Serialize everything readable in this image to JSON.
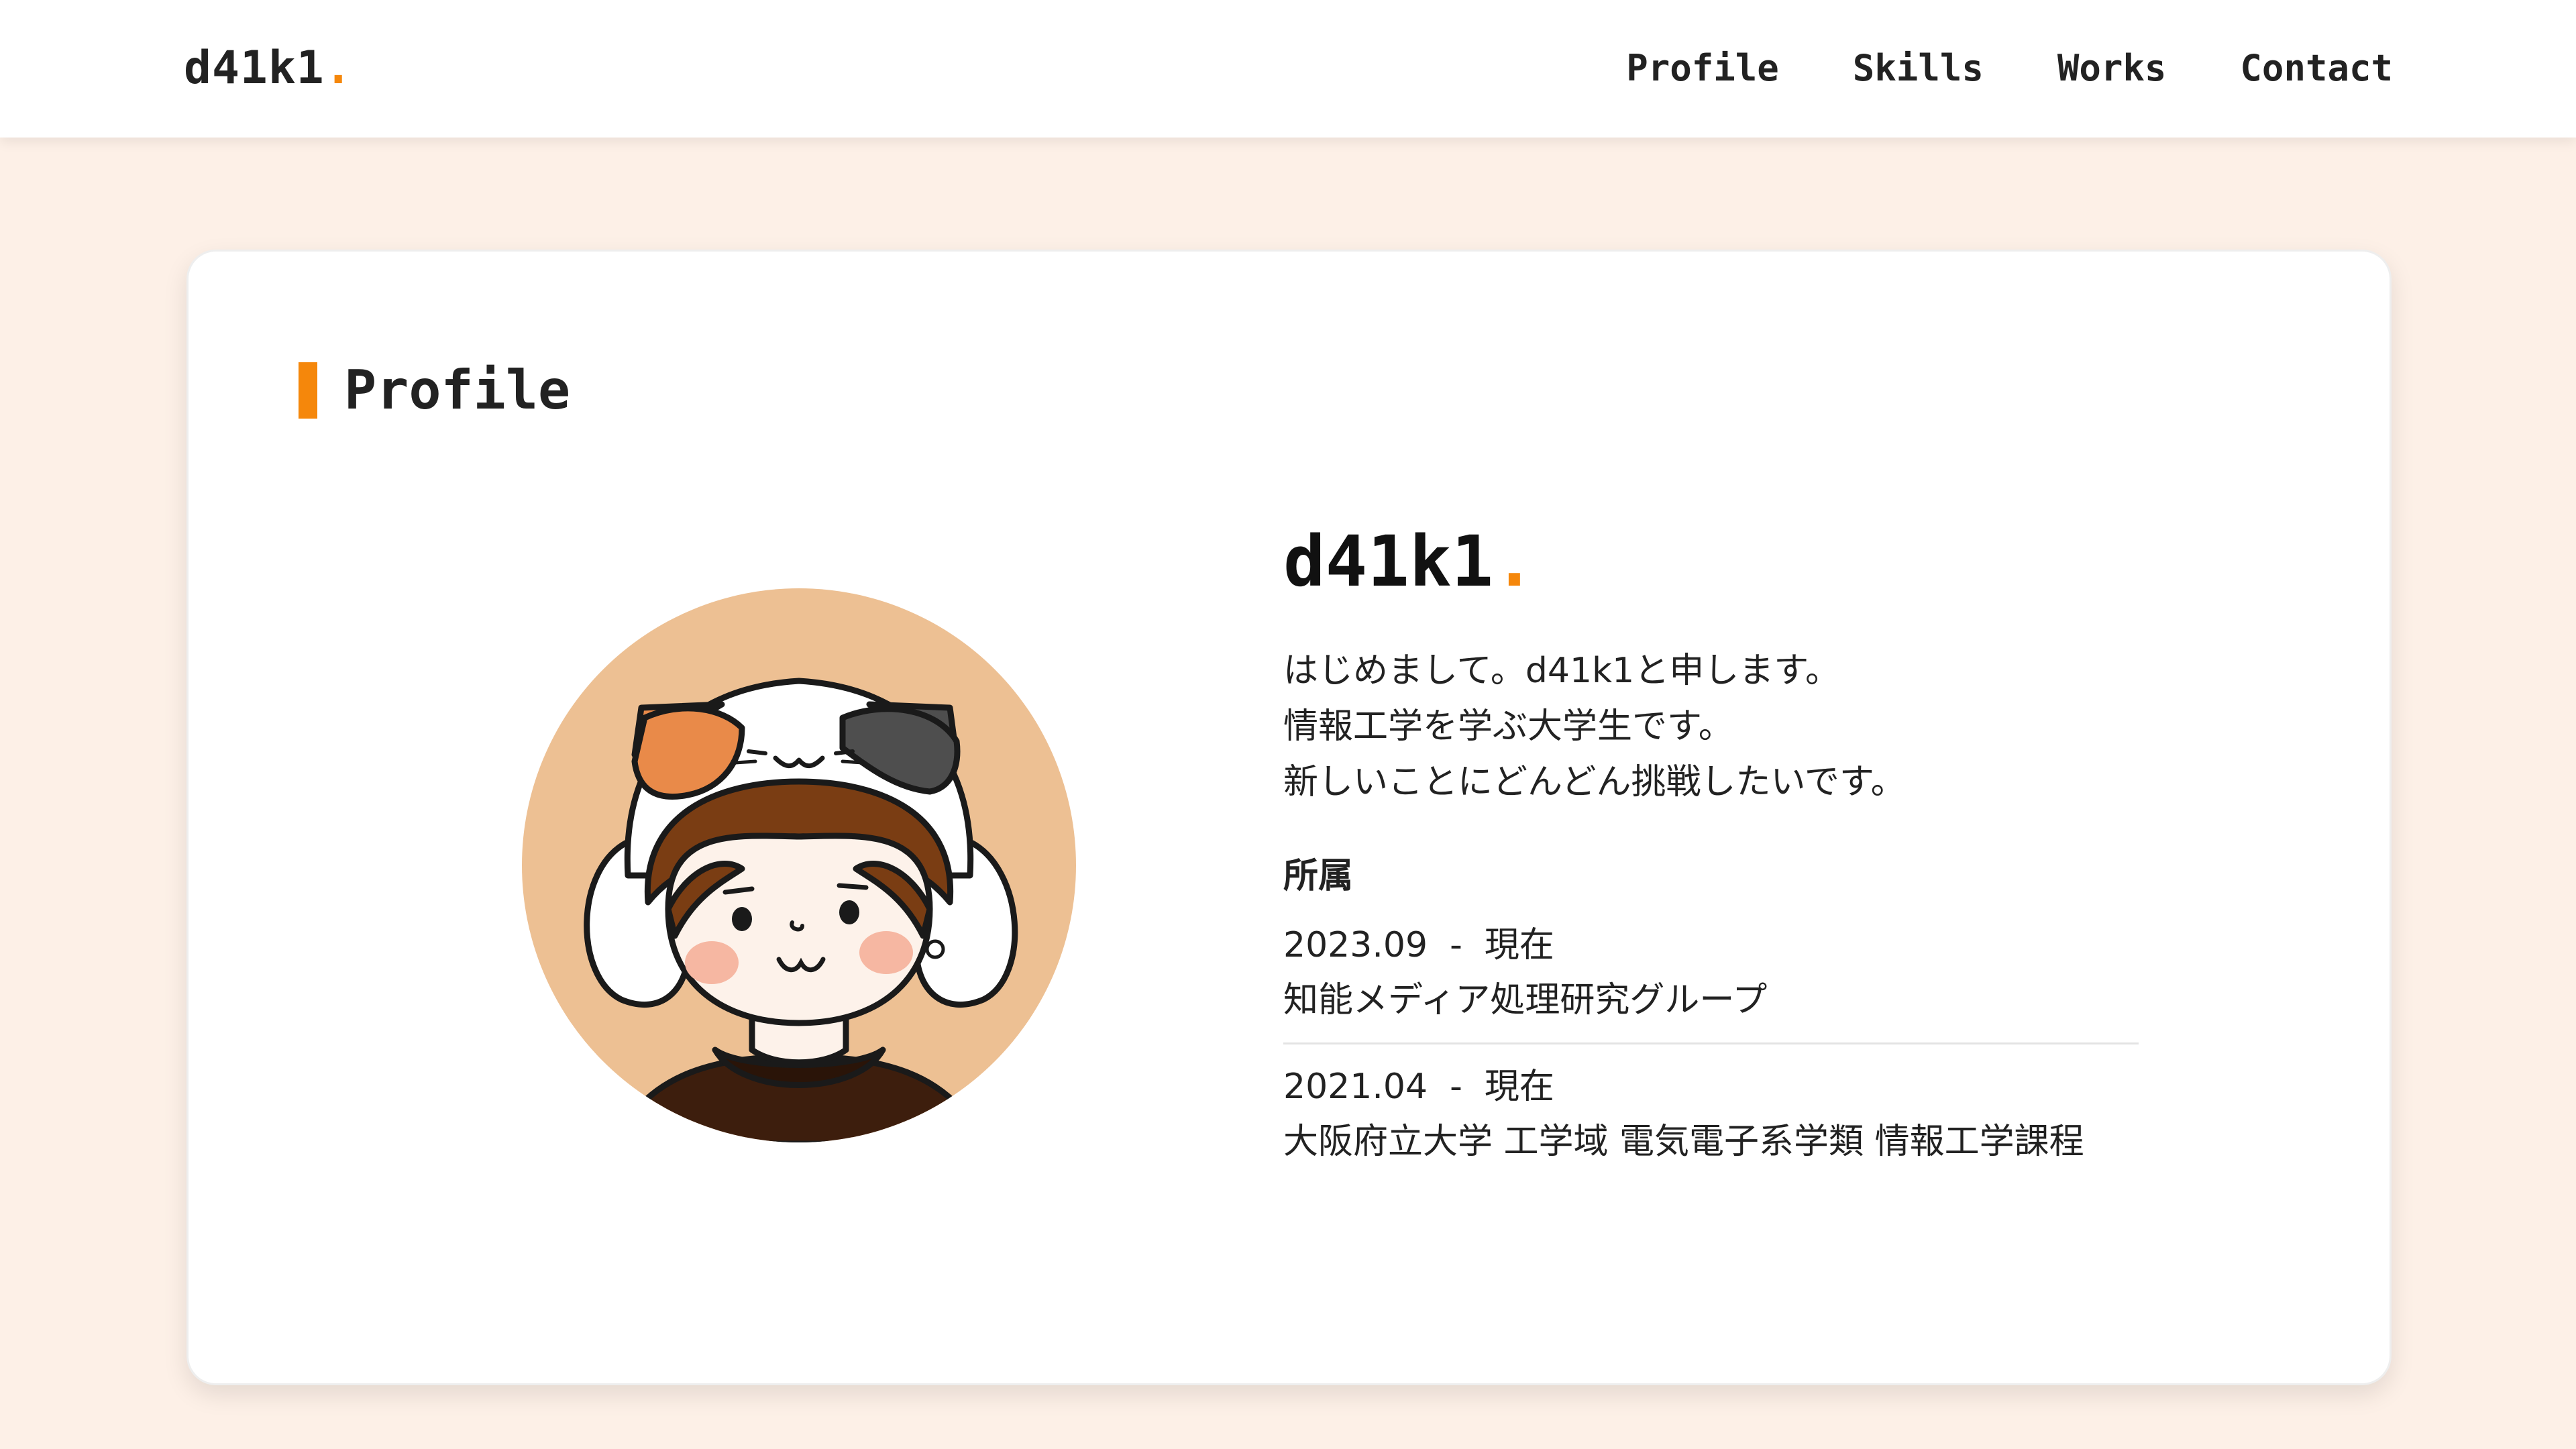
{
  "nav": {
    "brand": "d41k1",
    "brand_dot": ".",
    "links": [
      "Profile",
      "Skills",
      "Works",
      "Contact"
    ]
  },
  "profile": {
    "section_title": "Profile",
    "avatar_icon": "cat-hat-avatar-icon",
    "name": "d41k1",
    "name_dot": ".",
    "intro": [
      "はじめまして。d41k1と申します。",
      "情報工学を学ぶ大学生です。",
      "新しいことにどんどん挑戦したいです。"
    ],
    "affiliation_label": "所属",
    "affiliations": [
      {
        "period": "2023.09  -  現在",
        "org": "知能メディア処理研究グループ"
      },
      {
        "period": "2021.04  -  現在",
        "org": "大阪府立大学 工学域 電気電子系学類 情報工学課程"
      }
    ]
  },
  "colors": {
    "accent": "#f5870b",
    "page_background": "#fdf0e7",
    "avatar_background": "#edc093"
  }
}
